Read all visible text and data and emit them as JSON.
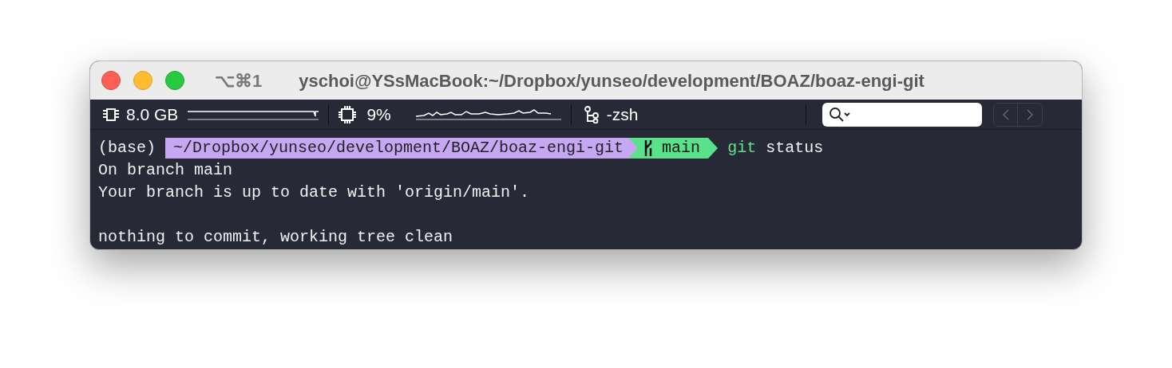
{
  "window": {
    "title": "yschoi@YSsMacBook:~/Dropbox/yunseo/development/BOAZ/boaz-engi-git",
    "shortcut": "⌥⌘1"
  },
  "status_bar": {
    "memory": "8.0 GB",
    "cpu": "9%",
    "job": "-zsh"
  },
  "terminal": {
    "prompt": {
      "env": "(base)",
      "path": "~/Dropbox/yunseo/development/BOAZ/boaz-engi-git",
      "branch": "main",
      "command": "git",
      "args": "status"
    },
    "output_paragraphs": [
      {
        "lines": [
          "On branch main",
          "Your branch is up to date with 'origin/main'."
        ]
      },
      {
        "lines": [
          "nothing to commit, working tree clean"
        ]
      }
    ]
  }
}
